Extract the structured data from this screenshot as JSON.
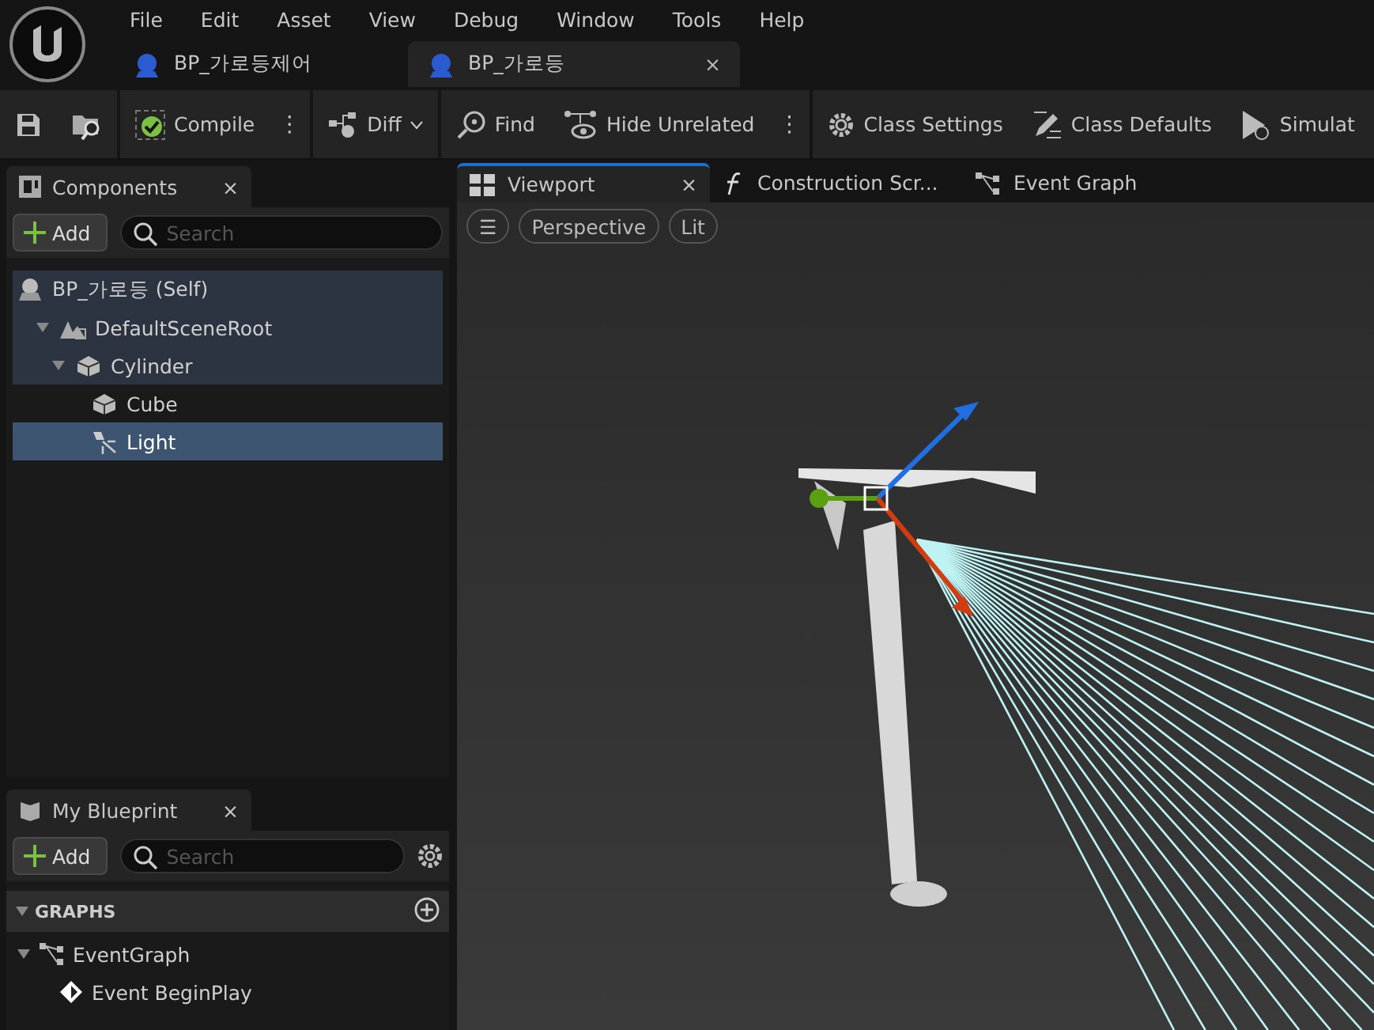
{
  "menu": [
    "File",
    "Edit",
    "Asset",
    "View",
    "Debug",
    "Window",
    "Tools",
    "Help"
  ],
  "doc_tabs": [
    {
      "label": "BP_가로등제어",
      "selected": false
    },
    {
      "label": "BP_가로등",
      "selected": true,
      "close": "×"
    }
  ],
  "toolbar": [
    {
      "kind": "save"
    },
    {
      "kind": "browse"
    },
    {
      "kind": "separator"
    },
    {
      "kind": "compile",
      "label": "Compile"
    },
    {
      "kind": "more",
      "label": "⋮"
    },
    {
      "kind": "separator"
    },
    {
      "kind": "diff",
      "label": "Diff"
    },
    {
      "kind": "separator"
    },
    {
      "kind": "find",
      "label": "Find"
    },
    {
      "kind": "hide",
      "label": "Hide Unrelated"
    },
    {
      "kind": "more",
      "label": "⋮"
    },
    {
      "kind": "separator"
    },
    {
      "kind": "settings",
      "label": "Class Settings"
    },
    {
      "kind": "defaults",
      "label": "Class Defaults"
    },
    {
      "kind": "simulate",
      "label": "Simulat"
    }
  ],
  "components": {
    "tab": "Components",
    "close": "×",
    "add": "Add",
    "search": {
      "placeholder": "Search"
    },
    "tree": [
      {
        "label": "BP_가로등 (Self)",
        "kind": "actor",
        "selected": false,
        "highlighted": true,
        "children": [
          {
            "label": "DefaultSceneRoot",
            "kind": "scene",
            "selected": false,
            "highlighted": true,
            "expanded": true,
            "children": [
              {
                "label": "Cylinder",
                "kind": "mesh",
                "selected": false,
                "highlighted": true,
                "expanded": true,
                "children": [
                  {
                    "label": "Cube",
                    "kind": "mesh",
                    "selected": false,
                    "highlighted": false
                  },
                  {
                    "label": "Light",
                    "kind": "light",
                    "selected": true
                  }
                ]
              }
            ]
          }
        ]
      }
    ]
  },
  "editor_tabs": [
    {
      "label": "Viewport",
      "kind": "viewport",
      "selected": true,
      "close": "×"
    },
    {
      "label": "Construction Scr...",
      "kind": "function",
      "selected": false
    },
    {
      "label": "Event Graph",
      "kind": "graph",
      "selected": false
    }
  ],
  "viewport_toolbar": {
    "menu": "☰",
    "buttons": [
      "Perspective",
      "Lit"
    ]
  },
  "my_blueprint": {
    "tab": "My Blueprint",
    "close": "×",
    "add": "Add",
    "search": {
      "placeholder": "Search"
    },
    "sections": [
      {
        "title": "GRAPHS",
        "expanded": true,
        "items": [
          {
            "label": "EventGraph",
            "kind": "graph",
            "expanded": true,
            "children": [
              {
                "label": "Event BeginPlay",
                "kind": "event"
              }
            ]
          }
        ]
      }
    ]
  }
}
